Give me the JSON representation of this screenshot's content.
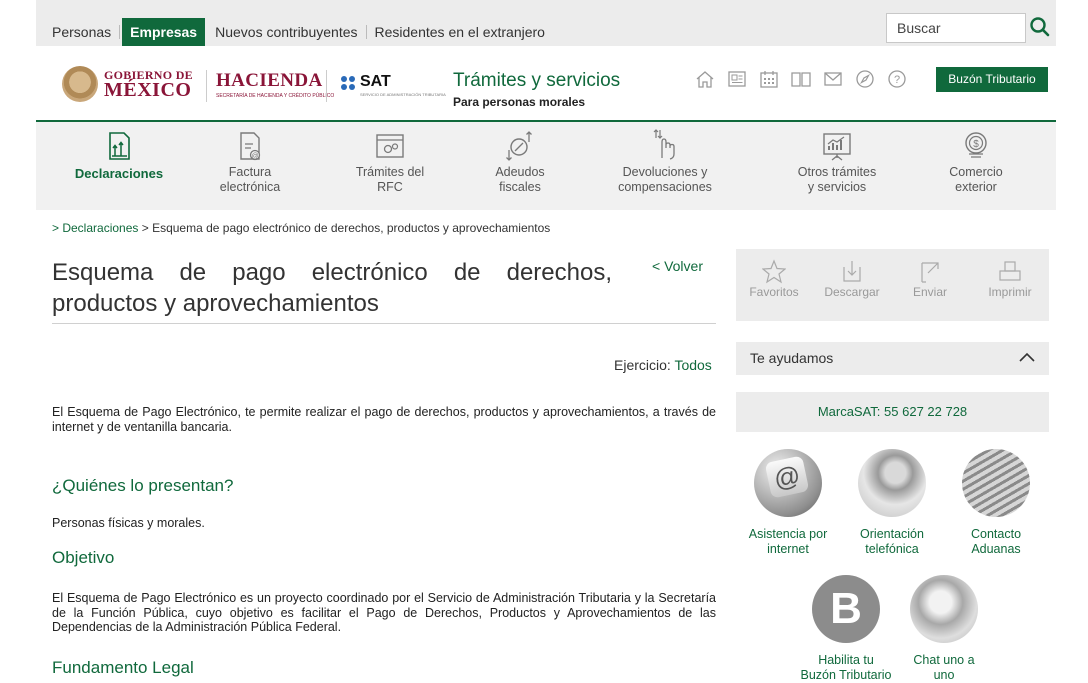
{
  "topnav": {
    "items": [
      "Personas",
      "Empresas",
      "Nuevos contribuyentes",
      "Residentes en el extranjero"
    ],
    "search_placeholder": "Buscar"
  },
  "header": {
    "gob_line1": "GOBIERNO DE",
    "gob_line2": "MÉXICO",
    "hacienda": "HACIENDA",
    "hacienda_sub": "SECRETARÍA DE HACIENDA Y CRÉDITO PÚBLICO",
    "sat": "SAT",
    "sat_sub": "SERVICIO DE ADMINISTRACIÓN TRIBUTARIA",
    "title": "Trámites y servicios",
    "subtitle": "Para personas morales",
    "buzon": "Buzón Tributario",
    "icons": [
      "home-icon",
      "document-icon",
      "calendar-icon",
      "book-icon",
      "mail-icon",
      "compass-icon",
      "help-icon"
    ]
  },
  "nav": {
    "items": [
      {
        "l1": "Declaraciones",
        "l2": ""
      },
      {
        "l1": "Factura",
        "l2": "electrónica"
      },
      {
        "l1": "Trámites del",
        "l2": "RFC"
      },
      {
        "l1": "Adeudos",
        "l2": "fiscales"
      },
      {
        "l1": "Devoluciones y",
        "l2": "compensaciones"
      },
      {
        "l1": "Otros trámites",
        "l2": "y servicios"
      },
      {
        "l1": "Comercio",
        "l2": "exterior"
      }
    ]
  },
  "breadcrumb": {
    "link": "> Declaraciones",
    "current": " > Esquema de pago electrónico de derechos, productos y aprovechamientos"
  },
  "main": {
    "title": "Esquema de pago electrónico de derechos, productos y aprovechamientos",
    "volver": "< Volver",
    "ejercicio_label": "Ejercicio: ",
    "ejercicio_value": "Todos",
    "intro": "El Esquema de Pago Electrónico, te permite realizar el pago de derechos, productos y aprovechamientos, a través de internet y de ventanilla bancaria.",
    "h_quienes": "¿Quiénes lo presentan?",
    "quienes": "Personas físicas y morales.",
    "h_objetivo": "Objetivo",
    "objetivo": "El Esquema de Pago Electrónico es un proyecto coordinado por el Servicio de Administración Tributaria y la Secretaría de la Función Pública, cuyo objetivo es facilitar el Pago de Derechos, Productos y Aprovechamientos de las Dependencias de la Administración Pública Federal.",
    "h_fundamento": "Fundamento Legal"
  },
  "sidebar": {
    "tools": [
      "Favoritos",
      "Descargar",
      "Enviar",
      "Imprimir"
    ],
    "ayudamos": "Te ayudamos",
    "marca": "MarcaSAT: 55 627 22 728",
    "help": [
      {
        "l1": "Asistencia por",
        "l2": "internet"
      },
      {
        "l1": "Orientación",
        "l2": "telefónica"
      },
      {
        "l1": "Contacto",
        "l2": "Aduanas"
      },
      {
        "l1": "Habilita tu",
        "l2": "Buzón Tributario"
      },
      {
        "l1": "Chat uno a",
        "l2": "uno"
      }
    ]
  },
  "colors": {
    "brand_green": "#10693c",
    "gob_red": "#8a1538"
  }
}
